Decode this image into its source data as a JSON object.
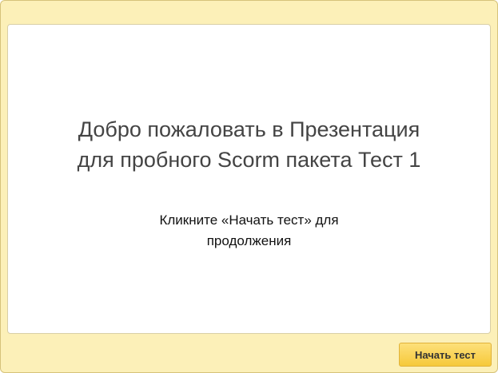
{
  "slide": {
    "title_line1": "Добро пожаловать в Презентация",
    "title_line2": "для пробного Scorm пакета Тест 1",
    "subtitle_line1": "Кликните «Начать тест» для",
    "subtitle_line2": "продолжения"
  },
  "footer": {
    "start_button_label": "Начать тест"
  },
  "colors": {
    "frame_background": "#fcf0b8",
    "button_accent": "#f6c93a"
  }
}
